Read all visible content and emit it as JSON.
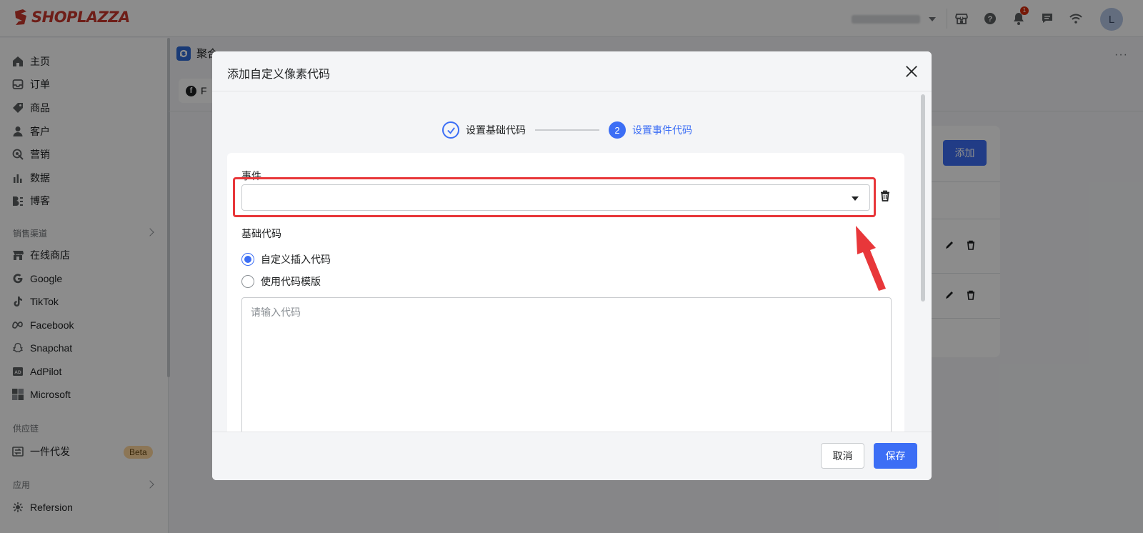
{
  "brand": {
    "name": "SHOPLAZZA",
    "color": "#c8372d"
  },
  "topbar": {
    "notification_count": "1",
    "avatar_initial": "L",
    "icons": [
      "store-icon",
      "help-icon",
      "bell-icon",
      "chat-icon",
      "wifi-icon"
    ]
  },
  "sidebar": {
    "items": [
      {
        "label": "主页",
        "icon": "home-icon"
      },
      {
        "label": "订单",
        "icon": "inbox-icon"
      },
      {
        "label": "商品",
        "icon": "tag-icon"
      },
      {
        "label": "客户",
        "icon": "person-icon"
      },
      {
        "label": "营销",
        "icon": "target-icon"
      },
      {
        "label": "数据",
        "icon": "bar-chart-icon"
      },
      {
        "label": "博客",
        "icon": "blog-icon"
      }
    ],
    "sales_section": "销售渠道",
    "sales_items": [
      {
        "label": "在线商店",
        "icon": "store-icon"
      },
      {
        "label": "Google",
        "icon": "google-icon"
      },
      {
        "label": "TikTok",
        "icon": "tiktok-icon"
      },
      {
        "label": "Facebook",
        "icon": "meta-icon"
      },
      {
        "label": "Snapchat",
        "icon": "snapchat-icon"
      },
      {
        "label": "AdPilot",
        "icon": "adpilot-icon"
      },
      {
        "label": "Microsoft",
        "icon": "microsoft-icon"
      }
    ],
    "supply_section": "供应链",
    "supply_items": [
      {
        "label": "一件代发",
        "icon": "dropship-icon",
        "badge": "Beta"
      }
    ],
    "apps_section": "应用",
    "apps_items": [
      {
        "label": "Refersion",
        "icon": "refersion-icon"
      }
    ]
  },
  "page": {
    "title": "聚合",
    "tab_label": "F",
    "add_button": "添加",
    "more": "···"
  },
  "modal": {
    "title": "添加自定义像素代码",
    "steps": [
      {
        "label": "设置基础代码",
        "status": "done"
      },
      {
        "number": "2",
        "label": "设置事件代码",
        "status": "active"
      }
    ],
    "event_label": "事件",
    "event_value": "",
    "base_code_label": "基础代码",
    "radio_options": [
      {
        "label": "自定义插入代码",
        "checked": true
      },
      {
        "label": "使用代码模版",
        "checked": false
      }
    ],
    "code_placeholder": "请输入代码",
    "cancel_label": "取消",
    "save_label": "保存"
  },
  "colors": {
    "accent": "#3c6ef5",
    "highlight": "#e8373a",
    "badge": "#ffd79d"
  }
}
